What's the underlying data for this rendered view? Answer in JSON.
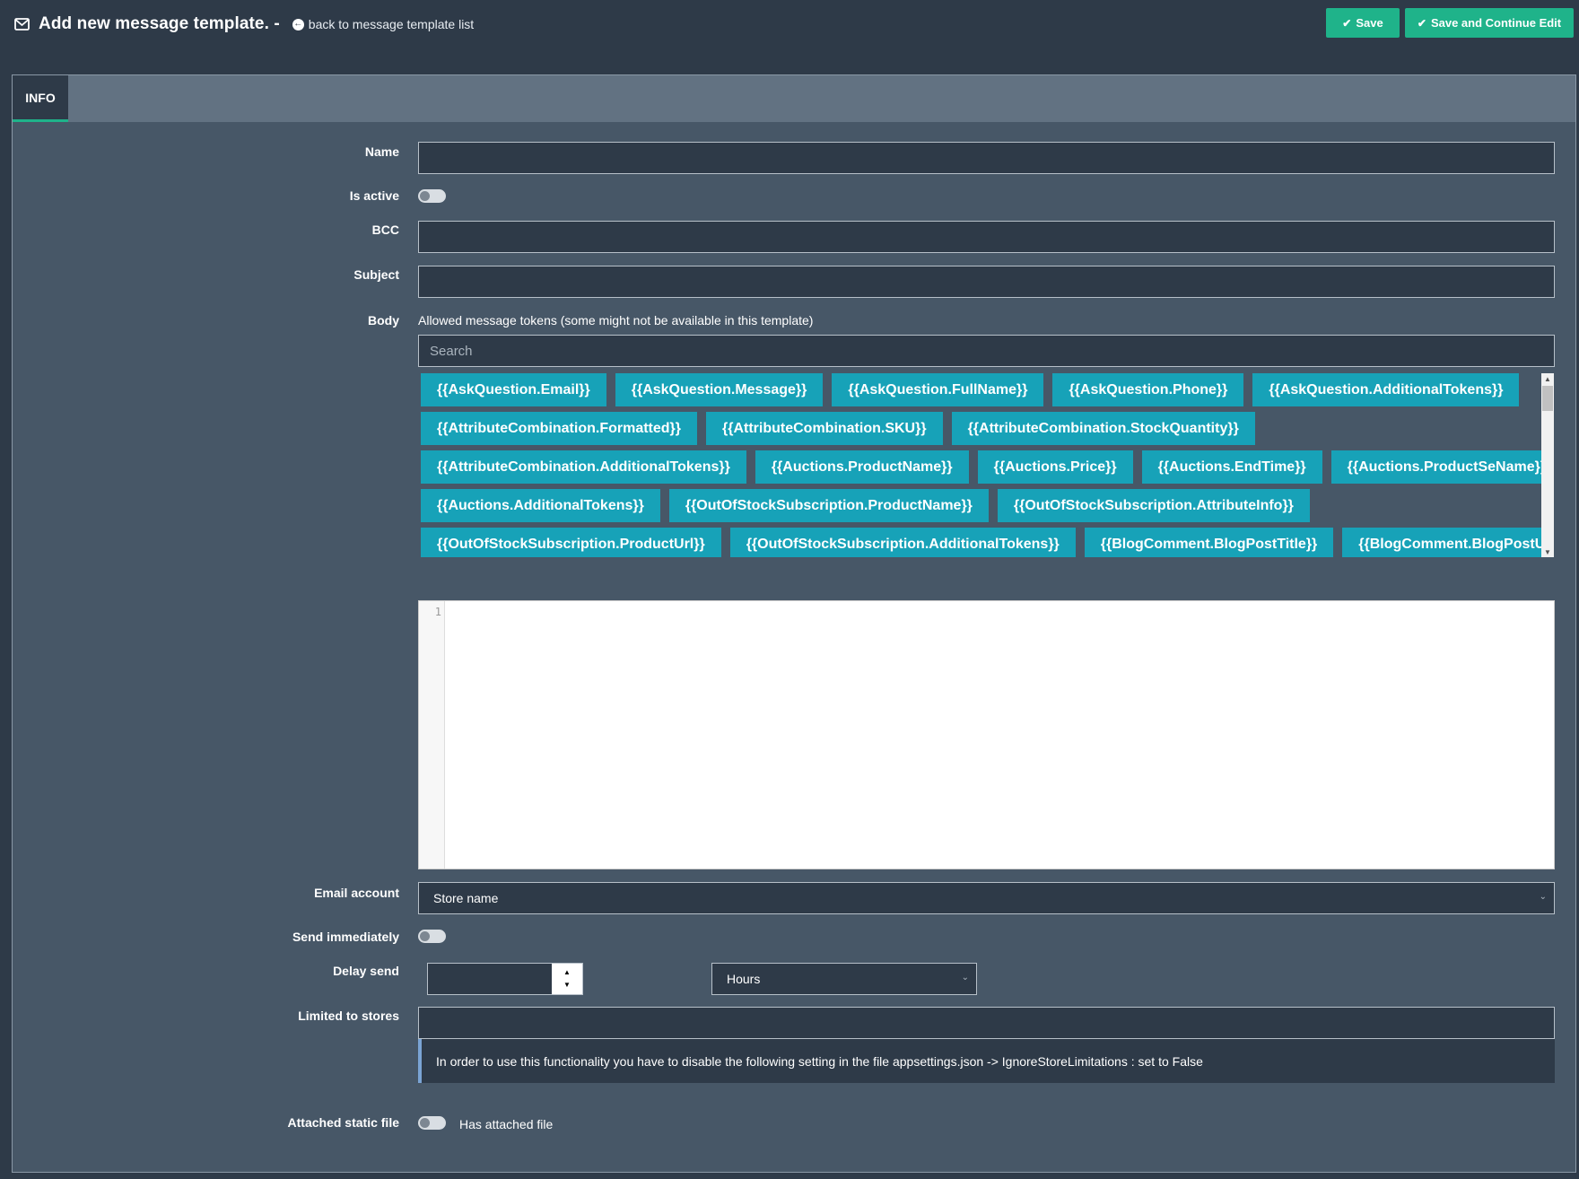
{
  "header": {
    "title": "Add new message template. -",
    "back_link": "back to message template list",
    "save_label": "Save",
    "save_continue_label": "Save and Continue Edit"
  },
  "tabs": [
    {
      "label": "INFO",
      "active": true
    }
  ],
  "form": {
    "name_label": "Name",
    "name_value": "",
    "is_active_label": "Is active",
    "is_active": false,
    "bcc_label": "BCC",
    "bcc_value": "",
    "subject_label": "Subject",
    "subject_value": "",
    "body_label": "Body",
    "body_hint": "Allowed message tokens (some might not be available in this template)",
    "search_placeholder": "Search",
    "token_rows": [
      [
        "{{AskQuestion.Email}}",
        "{{AskQuestion.Message}}",
        "{{AskQuestion.FullName}}",
        "{{AskQuestion.Phone}}",
        "{{AskQuestion.AdditionalTokens}}"
      ],
      [
        "{{AttributeCombination.Formatted}}",
        "{{AttributeCombination.SKU}}",
        "{{AttributeCombination.StockQuantity}}"
      ],
      [
        "{{AttributeCombination.AdditionalTokens}}",
        "{{Auctions.ProductName}}",
        "{{Auctions.Price}}",
        "{{Auctions.EndTime}}",
        "{{Auctions.ProductSeName}}"
      ],
      [
        "{{Auctions.AdditionalTokens}}",
        "{{OutOfStockSubscription.ProductName}}",
        "{{OutOfStockSubscription.AttributeInfo}}"
      ],
      [
        "{{OutOfStockSubscription.ProductUrl}}",
        "{{OutOfStockSubscription.AdditionalTokens}}",
        "{{BlogComment.BlogPostTitle}}",
        "{{BlogComment.BlogPostURL}}"
      ]
    ],
    "editor_line_number": "1",
    "email_account_label": "Email account",
    "email_account_value": "Store name",
    "send_immediately_label": "Send immediately",
    "send_immediately": false,
    "delay_send_label": "Delay send",
    "delay_value": "",
    "delay_unit": "Hours",
    "limited_stores_label": "Limited to stores",
    "limited_stores_info": "In order to use this functionality you have to disable the following setting in the file appsettings.json -> IgnoreStoreLimitations : set to False",
    "attached_file_label": "Attached static file",
    "attached_file": false,
    "has_attached_label": "Has attached file"
  },
  "icons": {
    "title_icon": "envelope-icon",
    "back_icon": "arrow-circle-left-icon",
    "save_icon": "check-icon",
    "save_continue_icon": "check-circle-icon"
  },
  "colors": {
    "accent": "#1fb38a",
    "token": "#17a2b8",
    "background": "#2e3a48",
    "panel": "#475767"
  }
}
